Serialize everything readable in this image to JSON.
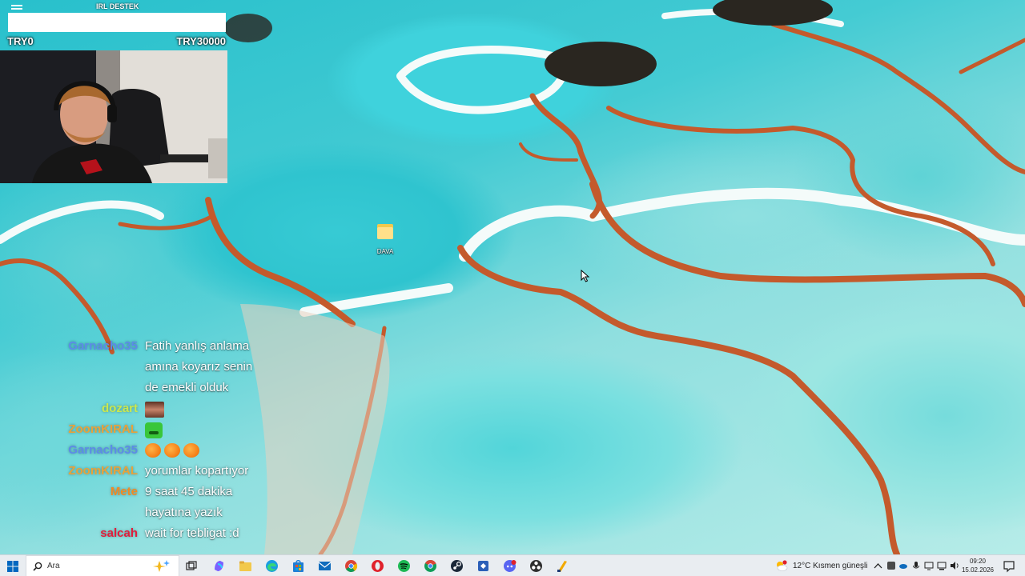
{
  "overlay": {
    "donation_title": "IRL DESTEK",
    "donation_current": "TRY0",
    "donation_goal": "TRY30000"
  },
  "desktop": {
    "icons": [
      {
        "label": "DAVA",
        "icon": "folder-icon"
      }
    ]
  },
  "chat": {
    "messages": [
      {
        "user": "Garnacho35",
        "color": "#5c8be8",
        "text": "Fatih yanlış anlama"
      },
      {
        "user": "",
        "color": "#ffffff",
        "text": "amına koyarız senin"
      },
      {
        "user": "",
        "color": "#ffffff",
        "text": "de emekli olduk"
      },
      {
        "user": "dozart",
        "color": "#c9e84f",
        "text": "",
        "emote": "face-emote"
      },
      {
        "user": "ZoomKIRAL",
        "color": "#e9a23a",
        "text": "",
        "emote": "green-emote"
      },
      {
        "user": "Garnacho35",
        "color": "#5c8be8",
        "text": "",
        "emote": "peach-emotes"
      },
      {
        "user": "ZoomKIRAL",
        "color": "#e9a23a",
        "text": "yorumlar kopartıyor"
      },
      {
        "user": "Mete",
        "color": "#f08a24",
        "text": "9 saat 45 dakika"
      },
      {
        "user": "",
        "color": "#ffffff",
        "text": "hayatına yazık"
      },
      {
        "user": "salcah",
        "color": "#e01e3c",
        "text": "wait for tebligat :d"
      }
    ]
  },
  "taskbar": {
    "search_placeholder": "Ara",
    "weather": "12°C  Kısmen güneşli",
    "time": "09:20",
    "date": "15.02.2026",
    "apps": [
      "copilot-icon",
      "folder-icon",
      "edge-icon",
      "store-icon",
      "mail-icon",
      "chrome-icon",
      "opera-icon",
      "spotify-icon",
      "chrome-alt-icon",
      "steam-icon",
      "app-icon",
      "discord-icon",
      "obs-icon",
      "tool-icon"
    ],
    "colors": {
      "accent": "#0067c0",
      "bar": "#e9edf1"
    }
  }
}
